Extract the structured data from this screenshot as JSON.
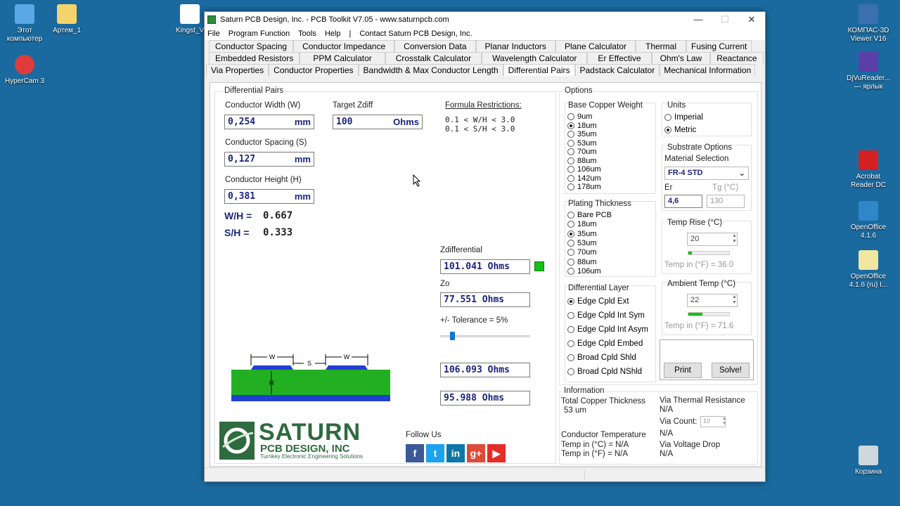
{
  "desktop": {
    "icons": [
      {
        "label": "Этот компьютер"
      },
      {
        "label": "Артем_1"
      },
      {
        "label": "HyperCam 3"
      },
      {
        "label": "Kingst_V"
      },
      {
        "label": "КОМПАС-3D Viewer V16"
      },
      {
        "label": "DjVuReader... — ярлык"
      },
      {
        "label": "Acrobat Reader DC"
      },
      {
        "label": "OpenOffice 4.1.6"
      },
      {
        "label": "OpenOffice 4.1.6 (ru) I..."
      },
      {
        "label": "Корзина"
      }
    ]
  },
  "window": {
    "title": "Saturn PCB Design, Inc. - PCB Toolkit V7.05 - www.saturnpcb.com",
    "controls": {
      "minimize": "—",
      "maximize": "☐",
      "close": "✕"
    }
  },
  "menu": [
    "File",
    "Program Function",
    "Tools",
    "Help",
    "|",
    "Contact Saturn PCB Design, Inc."
  ],
  "tabs": {
    "row1": [
      "Conductor Spacing",
      "Conductor Impedance",
      "Conversion Data",
      "Planar Inductors",
      "Plane Calculator",
      "Thermal",
      "Fusing Current"
    ],
    "row2": [
      "Embedded Resistors",
      "PPM Calculator",
      "Crosstalk Calculator",
      "Wavelength Calculator",
      "Er Effective",
      "Ohm's Law",
      "Reactance"
    ],
    "row3": [
      "Via Properties",
      "Conductor Properties",
      "Bandwidth & Max Conductor Length",
      "Differential Pairs",
      "Padstack Calculator",
      "Mechanical Information"
    ]
  },
  "diff": {
    "section": "Differential Pairs",
    "width_label": "Conductor Width (W)",
    "width_value": "0,254",
    "spacing_label": "Conductor Spacing (S)",
    "spacing_value": "0,127",
    "height_label": "Conductor Height (H)",
    "height_value": "0,381",
    "unit_mm": "mm",
    "target_label": "Target Zdiff",
    "target_value": "100",
    "unit_ohms": "Ohms",
    "wh_label": "W/H =",
    "wh_value": "0.667",
    "sh_label": "S/H =",
    "sh_value": "0.333",
    "restrictions_title": "Formula Restrictions:",
    "restriction1": "0.1 < W/H < 3.0",
    "restriction2": "0.1 < S/H < 3.0",
    "zdiff_label": "Zdifferential",
    "zdiff_value": "101.041 Ohms",
    "zdiff_status_color": "#16c016",
    "zo_label": "Zo",
    "zo_value": "77.551 Ohms",
    "tolerance_label": "+/- Tolerance = 5%",
    "tolerance_slider_fraction": 0.05,
    "tol_high": "106.093 Ohms",
    "tol_low": "95.988 Ohms",
    "diagram": {
      "w": "W",
      "s": "S",
      "h": "H"
    }
  },
  "options": {
    "title": "Options",
    "copper_title": "Base Copper Weight",
    "copper": [
      "9um",
      "18um",
      "35um",
      "53um",
      "70um",
      "88um",
      "106um",
      "142um",
      "178um"
    ],
    "copper_selected": "18um",
    "plating_title": "Plating Thickness",
    "plating": [
      "Bare PCB",
      "18um",
      "35um",
      "53um",
      "70um",
      "88um",
      "106um"
    ],
    "plating_selected": "35um",
    "layer_title": "Differential Layer",
    "layers": [
      "Edge Cpld Ext",
      "Edge Cpld Int Sym",
      "Edge Cpld Int Asym",
      "Edge Cpld Embed",
      "Broad Cpld Shld",
      "Broad Cpld NShld"
    ],
    "layer_selected": "Edge Cpld Ext",
    "units_title": "Units",
    "units": [
      "Imperial",
      "Metric"
    ],
    "units_selected": "Metric",
    "substrate_title": "Substrate Options",
    "material_label": "Material Selection",
    "material_value": "FR-4 STD",
    "er_label": "Er",
    "er_value": "4,6",
    "tg_label": "Tg (°C)",
    "tg_value": "130",
    "temprise_title": "Temp Rise (°C)",
    "temprise_value": "20",
    "temprise_f": "Temp in (°F) = 36.0",
    "temprise_level": 0.08,
    "ambient_title": "Ambient Temp (°C)",
    "ambient_value": "22",
    "ambient_f": "Temp in (°F) = 71.6",
    "ambient_level": 0.35,
    "print_label": "Print",
    "solve_label": "Solve!"
  },
  "info": {
    "title": "Information",
    "copper_label": "Total Copper Thickness",
    "copper_value": "53 um",
    "cond_temp_label": "Conductor Temperature",
    "temp_c": "Temp in (°C) = N/A",
    "temp_f": "Temp in (°F) = N/A",
    "via_thermal_label": "Via Thermal Resistance",
    "via_thermal_value": "N/A",
    "via_count_label": "Via Count:",
    "via_count_value": "10",
    "via_count_result": "N/A",
    "via_voltage_label": "Via Voltage Drop",
    "via_voltage_value": "N/A"
  },
  "brand": {
    "logo_main": "SATURN",
    "logo_sub": "PCB DESIGN, INC",
    "logo_tag": "Turnkey Electronic Engineering Solutions",
    "follow": "Follow Us",
    "social": [
      {
        "icon": "facebook-icon",
        "glyph": "f",
        "color": "#3b5998"
      },
      {
        "icon": "twitter-icon",
        "glyph": "t",
        "color": "#1da1f2"
      },
      {
        "icon": "linkedin-icon",
        "glyph": "in",
        "color": "#0e76a8"
      },
      {
        "icon": "googleplus-icon",
        "glyph": "g+",
        "color": "#dd4b39"
      },
      {
        "icon": "youtube-icon",
        "glyph": "▶",
        "color": "#e52d27"
      }
    ]
  }
}
